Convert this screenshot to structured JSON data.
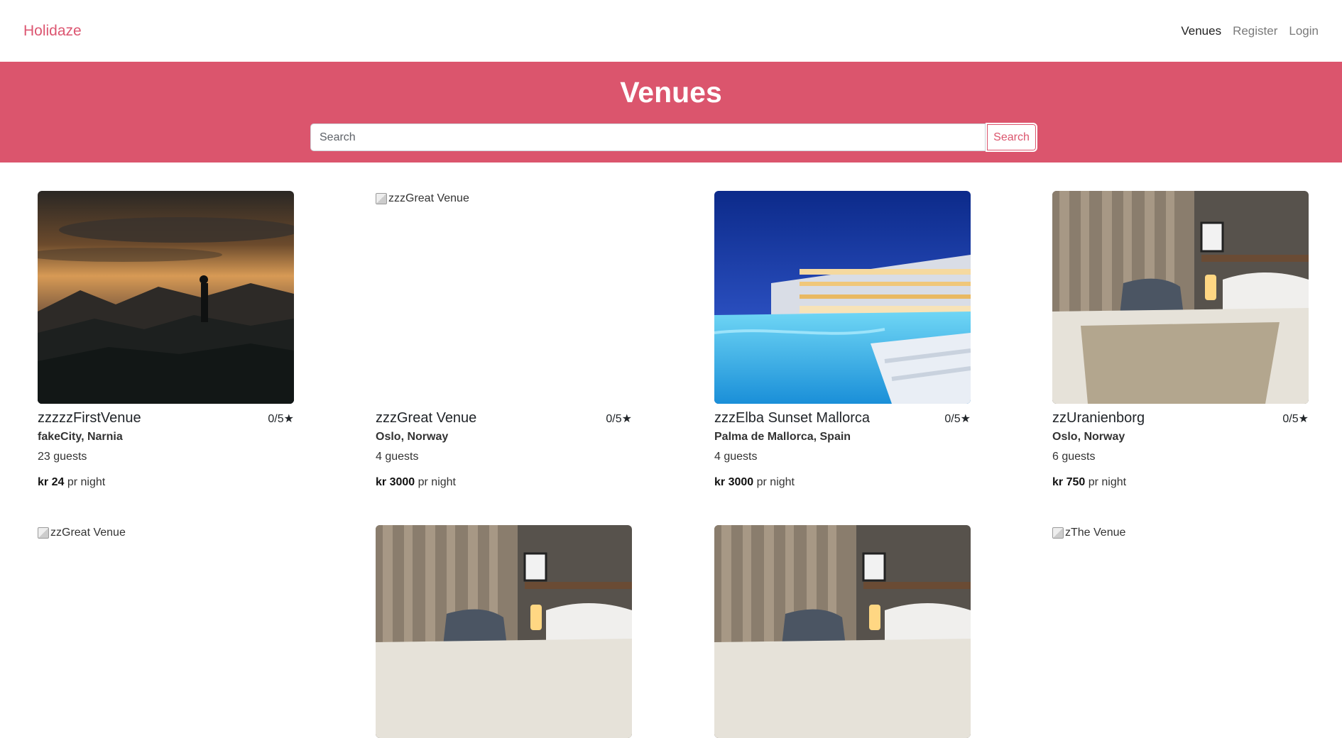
{
  "nav": {
    "brand": "Holidaze",
    "links": [
      "Venues",
      "Register",
      "Login"
    ]
  },
  "hero": {
    "title": "Venues",
    "search_placeholder": "Search",
    "search_button": "Search"
  },
  "venues": [
    {
      "name": "zzzzzFirstVenue",
      "rating": "0/5★",
      "location": "fakeCity, Narnia",
      "guests": "23 guests",
      "price": "kr 24",
      "price_suffix": " pr night",
      "image": "sunset-mountain"
    },
    {
      "name": "zzzGreat Venue",
      "rating": "0/5★",
      "location": "Oslo, Norway",
      "guests": "4 guests",
      "price": "kr 3000",
      "price_suffix": " pr night",
      "image_alt": "zzzGreat Venue"
    },
    {
      "name": "zzzElba Sunset Mallorca",
      "rating": "0/5★",
      "location": "Palma de Mallorca, Spain",
      "guests": "4 guests",
      "price": "kr 3000",
      "price_suffix": " pr night",
      "image": "hotel-pool-night"
    },
    {
      "name": "zzUranienborg",
      "rating": "0/5★",
      "location": "Oslo, Norway",
      "guests": "6 guests",
      "price": "kr 750",
      "price_suffix": " pr night",
      "image": "hotel-bedroom"
    },
    {
      "image_alt": "zzGreat Venue"
    },
    {
      "image": "hotel-bedroom"
    },
    {
      "image": "hotel-bedroom"
    },
    {
      "image_alt": "zThe Venue"
    }
  ]
}
